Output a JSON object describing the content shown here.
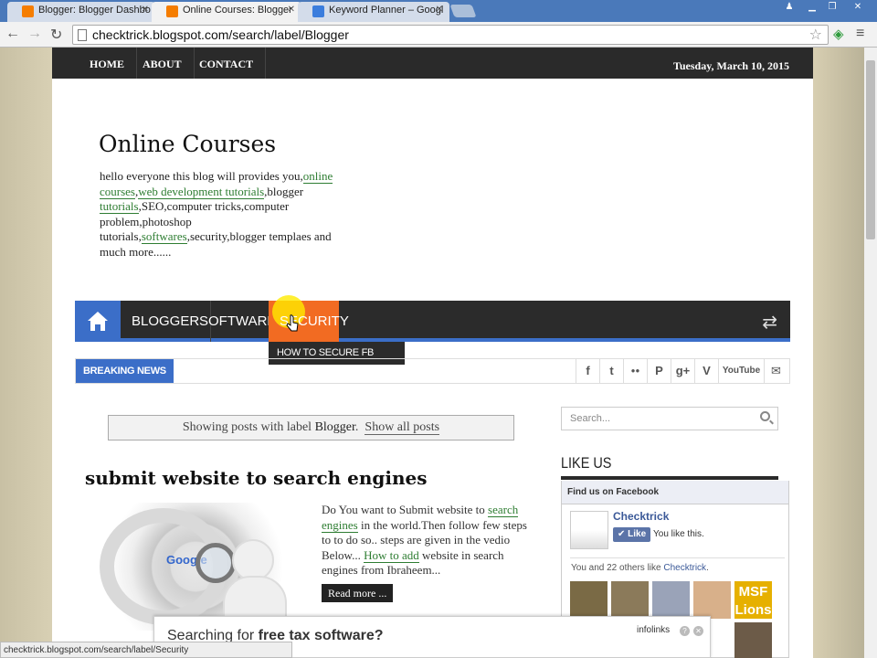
{
  "browser": {
    "tabs": [
      {
        "title": "Blogger: Blogger Dashbo",
        "active": false,
        "favicon_color": "#f57d00"
      },
      {
        "title": "Online Courses: Blogger",
        "active": true,
        "favicon_color": "#f57d00"
      },
      {
        "title": "Keyword Planner – Googl",
        "active": false,
        "favicon_color": "#3b7ddd"
      }
    ],
    "address": "checktrick.blogspot.com/search/label/Blogger",
    "status_url": "checktrick.blogspot.com/search/label/Security"
  },
  "page": {
    "topnav": [
      "HOME",
      "ABOUT",
      "CONTACT"
    ],
    "date": "Tuesday, March 10, 2015",
    "blog_title": "Online Courses",
    "description": {
      "p1": "hello everyone this blog will provides you,",
      "l1": "online courses",
      "p2": ",",
      "l2": "web development tutorials",
      "p3": ",blogger ",
      "l3": "tutorials",
      "p4": ",SEO,computer tricks,computer problem,photoshop tutorials,",
      "l4": "softwares",
      "p5": ",security,blogger templaes and much more......"
    },
    "mainnav": [
      "BLOGGER",
      "SOFTWARES",
      "SECURITY"
    ],
    "dropdown": "HOW TO SECURE FB ACCOUNT",
    "breaking_label": "BREAKING NEWS",
    "social_icons": [
      "facebook-icon",
      "twitter-icon",
      "flickr-icon",
      "pinterest-icon",
      "googleplus-icon",
      "vimeo-icon",
      "youtube-icon",
      "mail-icon"
    ],
    "social_glyphs": [
      "f",
      "t",
      "●●",
      "P",
      "g+",
      "V",
      "YouTube",
      "✉"
    ],
    "showing": {
      "prefix": "Showing posts with label",
      "label": "Blogger",
      "suffix": ".",
      "link": "Show all posts"
    },
    "post": {
      "title": "submit website to search engines",
      "t1": "Do You want to Submit website to ",
      "l1": "search engines",
      "t2": " in the world.Then follow few steps to to do so.. steps are given in the vedio Below... ",
      "l2": "How to add",
      "t3": " website in search engines from Ibraheem...",
      "read_more": "Read more ..."
    },
    "sidebar": {
      "search_placeholder": "Search...",
      "like_us": "LIKE US",
      "fb_header": "Find us on Facebook",
      "fb_name": "Checktrick",
      "fb_like": "Like",
      "fb_you_like": "You like this.",
      "fb_others_prefix": "You and 22 others like ",
      "fb_others_link": "Checktrick",
      "fb_others_suffix": ".",
      "msf_text": "MSF Lions"
    },
    "ad": {
      "text_prefix": "Searching for ",
      "text_bold": "free tax software?",
      "brand": "infolinks"
    }
  },
  "colors": {
    "accent": "#3b6ec8",
    "hot": "#f26b22",
    "link_green": "#2e7d32",
    "dark": "#2a2a2a"
  }
}
